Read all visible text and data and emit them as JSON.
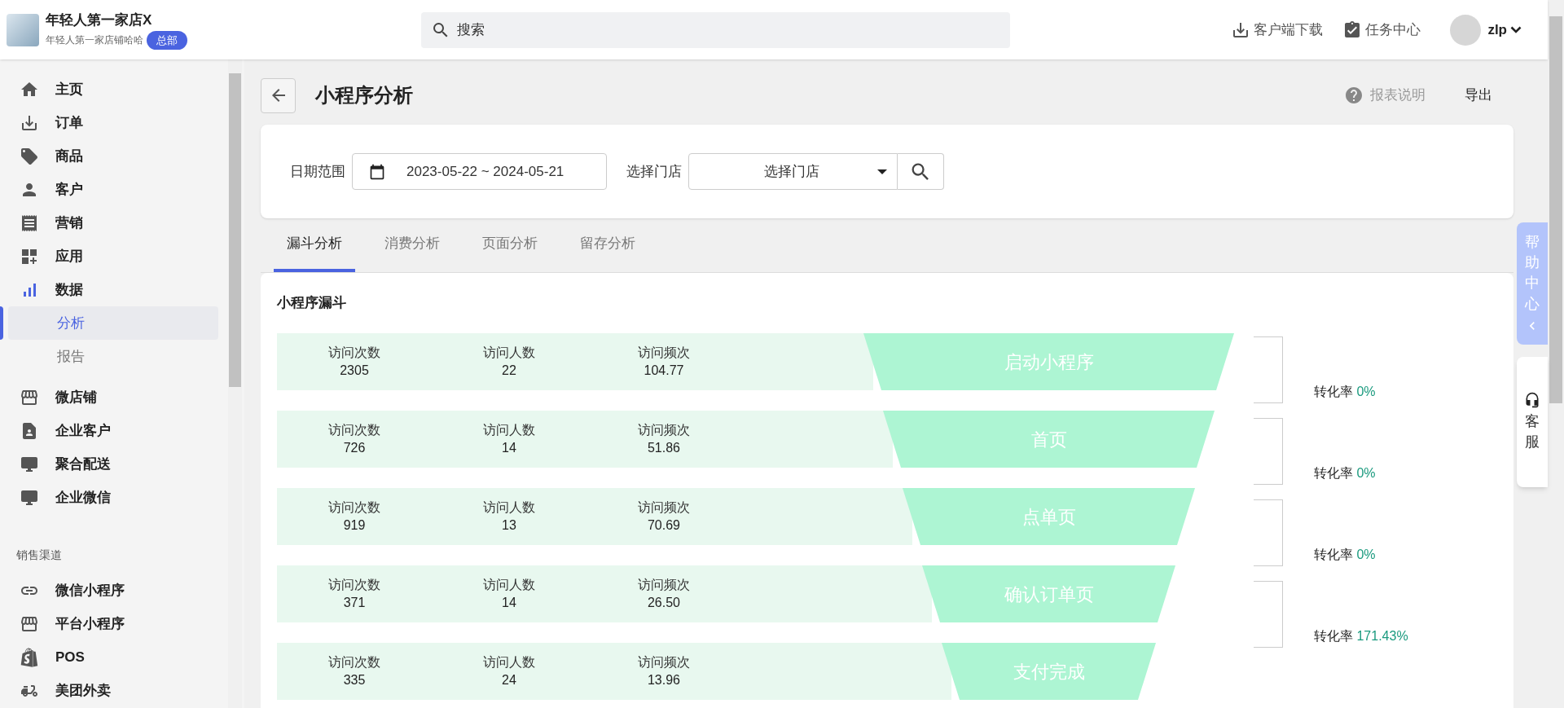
{
  "header": {
    "store_name": "年轻人第一家店X",
    "store_subtitle": "年轻人第一家店铺哈哈",
    "badge": "总部",
    "search": {
      "placeholder": "搜索"
    },
    "actions": [
      {
        "label": "客户端下载"
      },
      {
        "label": "任务中心"
      }
    ],
    "user": "zlp"
  },
  "sidebar": {
    "items": [
      {
        "label": "主页",
        "selected": false
      },
      {
        "label": "订单",
        "selected": false
      },
      {
        "label": "商品",
        "selected": false
      },
      {
        "label": "客户",
        "selected": false
      },
      {
        "label": "营销",
        "selected": false
      },
      {
        "label": "应用",
        "selected": false
      },
      {
        "label": "数据",
        "selected": false,
        "expanded": true,
        "children": [
          {
            "label": "分析",
            "selected": true
          },
          {
            "label": "报告",
            "selected": false
          }
        ]
      },
      {
        "label": "微店铺",
        "selected": false
      },
      {
        "label": "企业客户",
        "selected": false
      },
      {
        "label": "聚合配送",
        "selected": false
      },
      {
        "label": "企业微信",
        "selected": false
      }
    ],
    "section": {
      "title": "销售渠道",
      "items": [
        {
          "label": "微信小程序",
          "selected": false
        },
        {
          "label": "平台小程序",
          "selected": false
        },
        {
          "label": "POS",
          "selected": false
        },
        {
          "label": "美团外卖",
          "selected": false
        }
      ]
    }
  },
  "page": {
    "title": "小程序分析",
    "help_link": "报表说明",
    "export": "导出"
  },
  "filters": {
    "date_label": "日期范围",
    "date_value": "2023-05-22 ~ 2024-05-21",
    "store_label": "选择门店",
    "store_value": "选择门店"
  },
  "tabs": [
    {
      "label": "漏斗分析",
      "selected": true
    },
    {
      "label": "消费分析",
      "selected": false
    },
    {
      "label": "页面分析",
      "selected": false
    },
    {
      "label": "留存分析",
      "selected": false
    }
  ],
  "funnel": {
    "title": "小程序漏斗",
    "stages": [
      {
        "name": "启动小程序",
        "stats": [
          {
            "label": "访问次数",
            "value": "2305"
          },
          {
            "label": "访问人数",
            "value": "22"
          },
          {
            "label": "访问频次",
            "value": "104.77"
          }
        ]
      },
      {
        "name": "首页",
        "stats": [
          {
            "label": "访问次数",
            "value": "726"
          },
          {
            "label": "访问人数",
            "value": "14"
          },
          {
            "label": "访问频次",
            "value": "51.86"
          }
        ]
      },
      {
        "name": "点单页",
        "stats": [
          {
            "label": "访问次数",
            "value": "919"
          },
          {
            "label": "访问人数",
            "value": "13"
          },
          {
            "label": "访问频次",
            "value": "70.69"
          }
        ]
      },
      {
        "name": "确认订单页",
        "stats": [
          {
            "label": "访问次数",
            "value": "371"
          },
          {
            "label": "访问人数",
            "value": "14"
          },
          {
            "label": "访问频次",
            "value": "26.50"
          }
        ]
      },
      {
        "name": "支付完成",
        "stats": [
          {
            "label": "访问次数",
            "value": "335"
          },
          {
            "label": "访问人数",
            "value": "24"
          },
          {
            "label": "访问频次",
            "value": "13.96"
          }
        ]
      }
    ],
    "conversions": [
      {
        "label": "转化率",
        "value": "0%"
      },
      {
        "label": "转化率",
        "value": "0%"
      },
      {
        "label": "转化率",
        "value": "0%"
      },
      {
        "label": "转化率",
        "value": "171.43%"
      }
    ]
  },
  "floating": {
    "help": "帮助中心",
    "service": "客服"
  }
}
